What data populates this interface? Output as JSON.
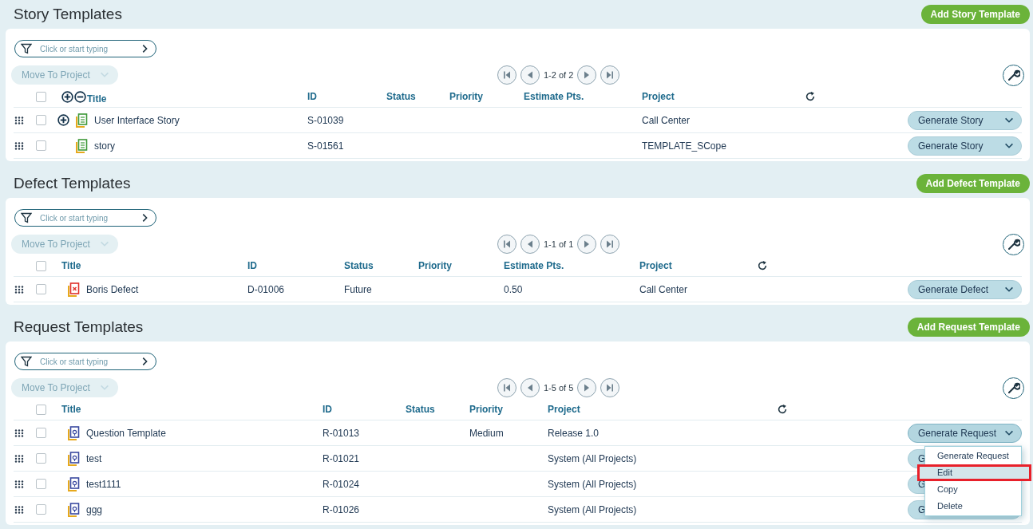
{
  "sections": [
    {
      "kind": "story",
      "title": "Story Templates",
      "add_button": "Add Story Template",
      "filter": {
        "placeholder": "Click or start typing"
      },
      "move_button": "Move To Project",
      "pager": "1-2 of 2",
      "all_checked": false,
      "columns": [
        "Title",
        "ID",
        "Status",
        "Priority",
        "Estimate Pts.",
        "Project"
      ],
      "rows": [
        {
          "checked": false,
          "expandable": true,
          "cells": [
            "User Interface Story",
            "S-01039",
            "",
            "",
            "",
            "Call Center"
          ],
          "action": "Generate Story",
          "menu_open": false
        },
        {
          "checked": false,
          "expandable": false,
          "cells": [
            "story",
            "S-01561",
            "",
            "",
            "",
            "TEMPLATE_SCope"
          ],
          "action": "Generate Story",
          "menu_open": false
        }
      ]
    },
    {
      "kind": "defect",
      "title": "Defect Templates",
      "add_button": "Add Defect Template",
      "filter": {
        "placeholder": "Click or start typing"
      },
      "move_button": "Move To Project",
      "pager": "1-1 of 1",
      "all_checked": false,
      "columns": [
        "Title",
        "ID",
        "Status",
        "Priority",
        "Estimate Pts.",
        "Project"
      ],
      "rows": [
        {
          "checked": false,
          "cells": [
            "Boris Defect",
            "D-01006",
            "Future",
            "",
            "0.50",
            "Call Center"
          ],
          "action": "Generate Defect",
          "menu_open": false
        }
      ]
    },
    {
      "kind": "request",
      "title": "Request Templates",
      "add_button": "Add Request Template",
      "filter": {
        "placeholder": "Click or start typing"
      },
      "move_button": "Move To Project",
      "pager": "1-5 of 5",
      "all_checked": false,
      "columns": [
        "Title",
        "ID",
        "Status",
        "Priority",
        "Project"
      ],
      "rows": [
        {
          "checked": false,
          "cells": [
            "Question Template",
            "R-01013",
            "",
            "Medium",
            "Release 1.0"
          ],
          "action": "Generate Request",
          "menu_open": true
        },
        {
          "checked": false,
          "cells": [
            "test",
            "R-01021",
            "",
            "",
            "System (All Projects)"
          ],
          "action": "G",
          "menu_open": false
        },
        {
          "checked": false,
          "cells": [
            "test1111",
            "R-01024",
            "",
            "",
            "System (All Projects)"
          ],
          "action": "G",
          "menu_open": false
        },
        {
          "checked": false,
          "cells": [
            "ggg",
            "R-01026",
            "",
            "",
            "System (All Projects)"
          ],
          "action": "G",
          "menu_open": false
        }
      ]
    }
  ],
  "menu": {
    "items": [
      {
        "label": "Generate Request",
        "selected": false,
        "outlined": false
      },
      {
        "label": "Edit",
        "selected": true,
        "outlined": true
      },
      {
        "label": "Copy",
        "selected": false,
        "outlined": false
      },
      {
        "label": "Delete",
        "selected": false,
        "outlined": false
      }
    ]
  }
}
